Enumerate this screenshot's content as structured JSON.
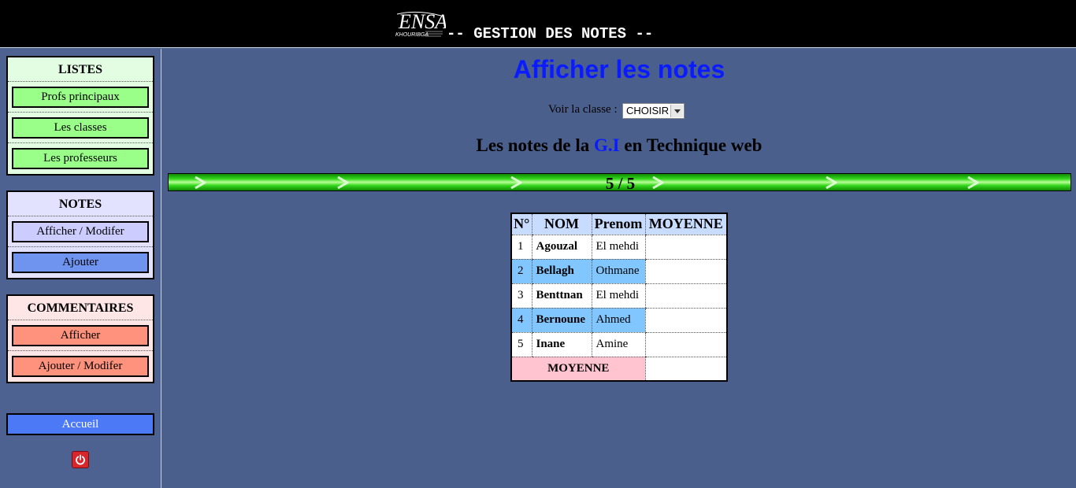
{
  "header": {
    "logo_text": "ENSA",
    "logo_subtext": "KHOURIBGA",
    "title": "-- GESTION DES NOTES --"
  },
  "sidebar": {
    "listes": {
      "title": "LISTES",
      "items": [
        "Profs principaux",
        "Les classes",
        "Les professeurs"
      ]
    },
    "notes": {
      "title": "NOTES",
      "items": [
        "Afficher / Modifer",
        "Ajouter"
      ]
    },
    "commentaires": {
      "title": "COMMENTAIRES",
      "items": [
        "Afficher",
        "Ajouter / Modifer"
      ]
    },
    "accueil": "Accueil",
    "logout_icon": "power-icon"
  },
  "main": {
    "title": "Afficher les notes",
    "voir_label": "Voir la classe :",
    "class_select": "CHOISIR",
    "subtitle": {
      "prefix": "Les notes de la",
      "class": "G.I",
      "middle": "en",
      "subject": "Technique web"
    },
    "progress": {
      "text": "5 / 5",
      "fraction": 1.0
    },
    "table": {
      "headers": [
        "N°",
        "NOM",
        "Prenom",
        "MOYENNE"
      ],
      "rows": [
        {
          "num": "1",
          "nom": "Agouzal",
          "prenom": "El mehdi",
          "moyenne": ""
        },
        {
          "num": "2",
          "nom": "Bellagh",
          "prenom": "Othmane",
          "moyenne": ""
        },
        {
          "num": "3",
          "nom": "Benttnan",
          "prenom": "El mehdi",
          "moyenne": ""
        },
        {
          "num": "4",
          "nom": "Bernoune",
          "prenom": "Ahmed",
          "moyenne": ""
        },
        {
          "num": "5",
          "nom": "Inane",
          "prenom": "Amine",
          "moyenne": ""
        }
      ],
      "footer_label": "MOYENNE",
      "footer_value": ""
    }
  },
  "colors": {
    "header_bg": "#000000",
    "page_bg": "#4a5f8c",
    "title_blue": "#0a1cff",
    "listes_btn": "#99ff88",
    "notes_btn": "#ccccff",
    "ajouter_btn": "#6f94f0",
    "comm_btn": "#ff927c",
    "accueil_btn": "#4c79f6",
    "row_alt": "#82c6ff",
    "moyenne_label_bg": "#ffc4cf"
  }
}
